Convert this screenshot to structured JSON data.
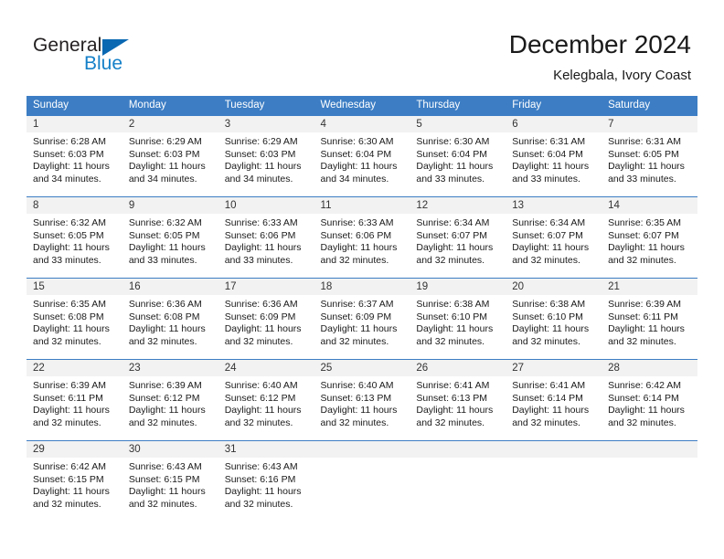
{
  "brand": {
    "name_dark": "General",
    "name_blue": "Blue",
    "accent_color": "#1580c8",
    "header_color": "#3c7dc4"
  },
  "header": {
    "title": "December 2024",
    "subtitle": "Kelegbala, Ivory Coast"
  },
  "calendar": {
    "weekday_headers": [
      "Sunday",
      "Monday",
      "Tuesday",
      "Wednesday",
      "Thursday",
      "Friday",
      "Saturday"
    ],
    "weeks": [
      [
        {
          "day": "1",
          "sunrise": "Sunrise: 6:28 AM",
          "sunset": "Sunset: 6:03 PM",
          "daylight1": "Daylight: 11 hours",
          "daylight2": "and 34 minutes."
        },
        {
          "day": "2",
          "sunrise": "Sunrise: 6:29 AM",
          "sunset": "Sunset: 6:03 PM",
          "daylight1": "Daylight: 11 hours",
          "daylight2": "and 34 minutes."
        },
        {
          "day": "3",
          "sunrise": "Sunrise: 6:29 AM",
          "sunset": "Sunset: 6:03 PM",
          "daylight1": "Daylight: 11 hours",
          "daylight2": "and 34 minutes."
        },
        {
          "day": "4",
          "sunrise": "Sunrise: 6:30 AM",
          "sunset": "Sunset: 6:04 PM",
          "daylight1": "Daylight: 11 hours",
          "daylight2": "and 34 minutes."
        },
        {
          "day": "5",
          "sunrise": "Sunrise: 6:30 AM",
          "sunset": "Sunset: 6:04 PM",
          "daylight1": "Daylight: 11 hours",
          "daylight2": "and 33 minutes."
        },
        {
          "day": "6",
          "sunrise": "Sunrise: 6:31 AM",
          "sunset": "Sunset: 6:04 PM",
          "daylight1": "Daylight: 11 hours",
          "daylight2": "and 33 minutes."
        },
        {
          "day": "7",
          "sunrise": "Sunrise: 6:31 AM",
          "sunset": "Sunset: 6:05 PM",
          "daylight1": "Daylight: 11 hours",
          "daylight2": "and 33 minutes."
        }
      ],
      [
        {
          "day": "8",
          "sunrise": "Sunrise: 6:32 AM",
          "sunset": "Sunset: 6:05 PM",
          "daylight1": "Daylight: 11 hours",
          "daylight2": "and 33 minutes."
        },
        {
          "day": "9",
          "sunrise": "Sunrise: 6:32 AM",
          "sunset": "Sunset: 6:05 PM",
          "daylight1": "Daylight: 11 hours",
          "daylight2": "and 33 minutes."
        },
        {
          "day": "10",
          "sunrise": "Sunrise: 6:33 AM",
          "sunset": "Sunset: 6:06 PM",
          "daylight1": "Daylight: 11 hours",
          "daylight2": "and 33 minutes."
        },
        {
          "day": "11",
          "sunrise": "Sunrise: 6:33 AM",
          "sunset": "Sunset: 6:06 PM",
          "daylight1": "Daylight: 11 hours",
          "daylight2": "and 32 minutes."
        },
        {
          "day": "12",
          "sunrise": "Sunrise: 6:34 AM",
          "sunset": "Sunset: 6:07 PM",
          "daylight1": "Daylight: 11 hours",
          "daylight2": "and 32 minutes."
        },
        {
          "day": "13",
          "sunrise": "Sunrise: 6:34 AM",
          "sunset": "Sunset: 6:07 PM",
          "daylight1": "Daylight: 11 hours",
          "daylight2": "and 32 minutes."
        },
        {
          "day": "14",
          "sunrise": "Sunrise: 6:35 AM",
          "sunset": "Sunset: 6:07 PM",
          "daylight1": "Daylight: 11 hours",
          "daylight2": "and 32 minutes."
        }
      ],
      [
        {
          "day": "15",
          "sunrise": "Sunrise: 6:35 AM",
          "sunset": "Sunset: 6:08 PM",
          "daylight1": "Daylight: 11 hours",
          "daylight2": "and 32 minutes."
        },
        {
          "day": "16",
          "sunrise": "Sunrise: 6:36 AM",
          "sunset": "Sunset: 6:08 PM",
          "daylight1": "Daylight: 11 hours",
          "daylight2": "and 32 minutes."
        },
        {
          "day": "17",
          "sunrise": "Sunrise: 6:36 AM",
          "sunset": "Sunset: 6:09 PM",
          "daylight1": "Daylight: 11 hours",
          "daylight2": "and 32 minutes."
        },
        {
          "day": "18",
          "sunrise": "Sunrise: 6:37 AM",
          "sunset": "Sunset: 6:09 PM",
          "daylight1": "Daylight: 11 hours",
          "daylight2": "and 32 minutes."
        },
        {
          "day": "19",
          "sunrise": "Sunrise: 6:38 AM",
          "sunset": "Sunset: 6:10 PM",
          "daylight1": "Daylight: 11 hours",
          "daylight2": "and 32 minutes."
        },
        {
          "day": "20",
          "sunrise": "Sunrise: 6:38 AM",
          "sunset": "Sunset: 6:10 PM",
          "daylight1": "Daylight: 11 hours",
          "daylight2": "and 32 minutes."
        },
        {
          "day": "21",
          "sunrise": "Sunrise: 6:39 AM",
          "sunset": "Sunset: 6:11 PM",
          "daylight1": "Daylight: 11 hours",
          "daylight2": "and 32 minutes."
        }
      ],
      [
        {
          "day": "22",
          "sunrise": "Sunrise: 6:39 AM",
          "sunset": "Sunset: 6:11 PM",
          "daylight1": "Daylight: 11 hours",
          "daylight2": "and 32 minutes."
        },
        {
          "day": "23",
          "sunrise": "Sunrise: 6:39 AM",
          "sunset": "Sunset: 6:12 PM",
          "daylight1": "Daylight: 11 hours",
          "daylight2": "and 32 minutes."
        },
        {
          "day": "24",
          "sunrise": "Sunrise: 6:40 AM",
          "sunset": "Sunset: 6:12 PM",
          "daylight1": "Daylight: 11 hours",
          "daylight2": "and 32 minutes."
        },
        {
          "day": "25",
          "sunrise": "Sunrise: 6:40 AM",
          "sunset": "Sunset: 6:13 PM",
          "daylight1": "Daylight: 11 hours",
          "daylight2": "and 32 minutes."
        },
        {
          "day": "26",
          "sunrise": "Sunrise: 6:41 AM",
          "sunset": "Sunset: 6:13 PM",
          "daylight1": "Daylight: 11 hours",
          "daylight2": "and 32 minutes."
        },
        {
          "day": "27",
          "sunrise": "Sunrise: 6:41 AM",
          "sunset": "Sunset: 6:14 PM",
          "daylight1": "Daylight: 11 hours",
          "daylight2": "and 32 minutes."
        },
        {
          "day": "28",
          "sunrise": "Sunrise: 6:42 AM",
          "sunset": "Sunset: 6:14 PM",
          "daylight1": "Daylight: 11 hours",
          "daylight2": "and 32 minutes."
        }
      ],
      [
        {
          "day": "29",
          "sunrise": "Sunrise: 6:42 AM",
          "sunset": "Sunset: 6:15 PM",
          "daylight1": "Daylight: 11 hours",
          "daylight2": "and 32 minutes."
        },
        {
          "day": "30",
          "sunrise": "Sunrise: 6:43 AM",
          "sunset": "Sunset: 6:15 PM",
          "daylight1": "Daylight: 11 hours",
          "daylight2": "and 32 minutes."
        },
        {
          "day": "31",
          "sunrise": "Sunrise: 6:43 AM",
          "sunset": "Sunset: 6:16 PM",
          "daylight1": "Daylight: 11 hours",
          "daylight2": "and 32 minutes."
        },
        {
          "day": "",
          "sunrise": "",
          "sunset": "",
          "daylight1": "",
          "daylight2": ""
        },
        {
          "day": "",
          "sunrise": "",
          "sunset": "",
          "daylight1": "",
          "daylight2": ""
        },
        {
          "day": "",
          "sunrise": "",
          "sunset": "",
          "daylight1": "",
          "daylight2": ""
        },
        {
          "day": "",
          "sunrise": "",
          "sunset": "",
          "daylight1": "",
          "daylight2": ""
        }
      ]
    ]
  }
}
